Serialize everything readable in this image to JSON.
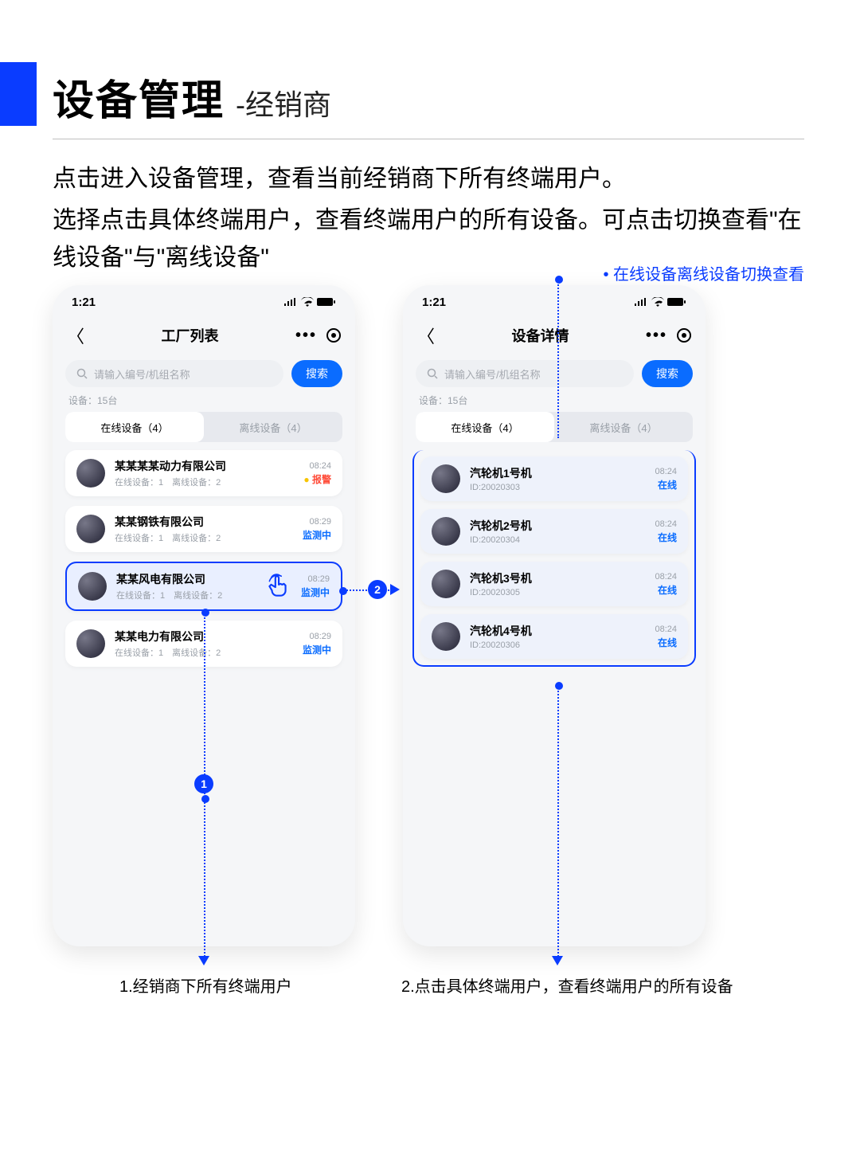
{
  "header": {
    "title_main": "设备管理",
    "title_sub": "-经销商"
  },
  "paragraphs": {
    "p1": "点击进入设备管理，查看当前经销商下所有终端用户。",
    "p2": "选择点击具体终端用户，查看终端用户的所有设备。可点击切换查看\"在线设备\"与\"离线设备\""
  },
  "annotations": {
    "top_right": "在线设备离线设备切换查看",
    "caption1": "1.经销商下所有终端用户",
    "caption2": "2.点击具体终端用户，查看终端用户的所有设备",
    "badges": {
      "b1": "1",
      "b2": "2"
    }
  },
  "common": {
    "time": "1:21",
    "search_placeholder": "请输入编号/机组名称",
    "search_button": "搜索",
    "device_count_label": "设备：15台",
    "tab_online": "在线设备（4）",
    "tab_offline": "离线设备（4）"
  },
  "left_phone": {
    "nav_title": "工厂列表",
    "items": [
      {
        "title": "某某某某动力有限公司",
        "sub": "在线设备：1　离线设备：2",
        "time": "08:24",
        "status": "报警",
        "status_type": "alarm",
        "selected": false
      },
      {
        "title": "某某钢铁有限公司",
        "sub": "在线设备：1　离线设备：2",
        "time": "08:29",
        "status": "监测中",
        "status_type": "monitor",
        "selected": false
      },
      {
        "title": "某某风电有限公司",
        "sub": "在线设备：1　离线设备：2",
        "time": "08:29",
        "status": "监测中",
        "status_type": "monitor",
        "selected": true
      },
      {
        "title": "某某电力有限公司",
        "sub": "在线设备：1　离线设备：2",
        "time": "08:29",
        "status": "监测中",
        "status_type": "monitor",
        "selected": false
      }
    ]
  },
  "right_phone": {
    "nav_title": "设备详情",
    "items": [
      {
        "title": "汽轮机1号机",
        "sub": "ID:20020303",
        "time": "08:24",
        "status": "在线"
      },
      {
        "title": "汽轮机2号机",
        "sub": "ID:20020304",
        "time": "08:24",
        "status": "在线"
      },
      {
        "title": "汽轮机3号机",
        "sub": "ID:20020305",
        "time": "08:24",
        "status": "在线"
      },
      {
        "title": "汽轮机4号机",
        "sub": "ID:20020306",
        "time": "08:24",
        "status": "在线"
      }
    ]
  }
}
